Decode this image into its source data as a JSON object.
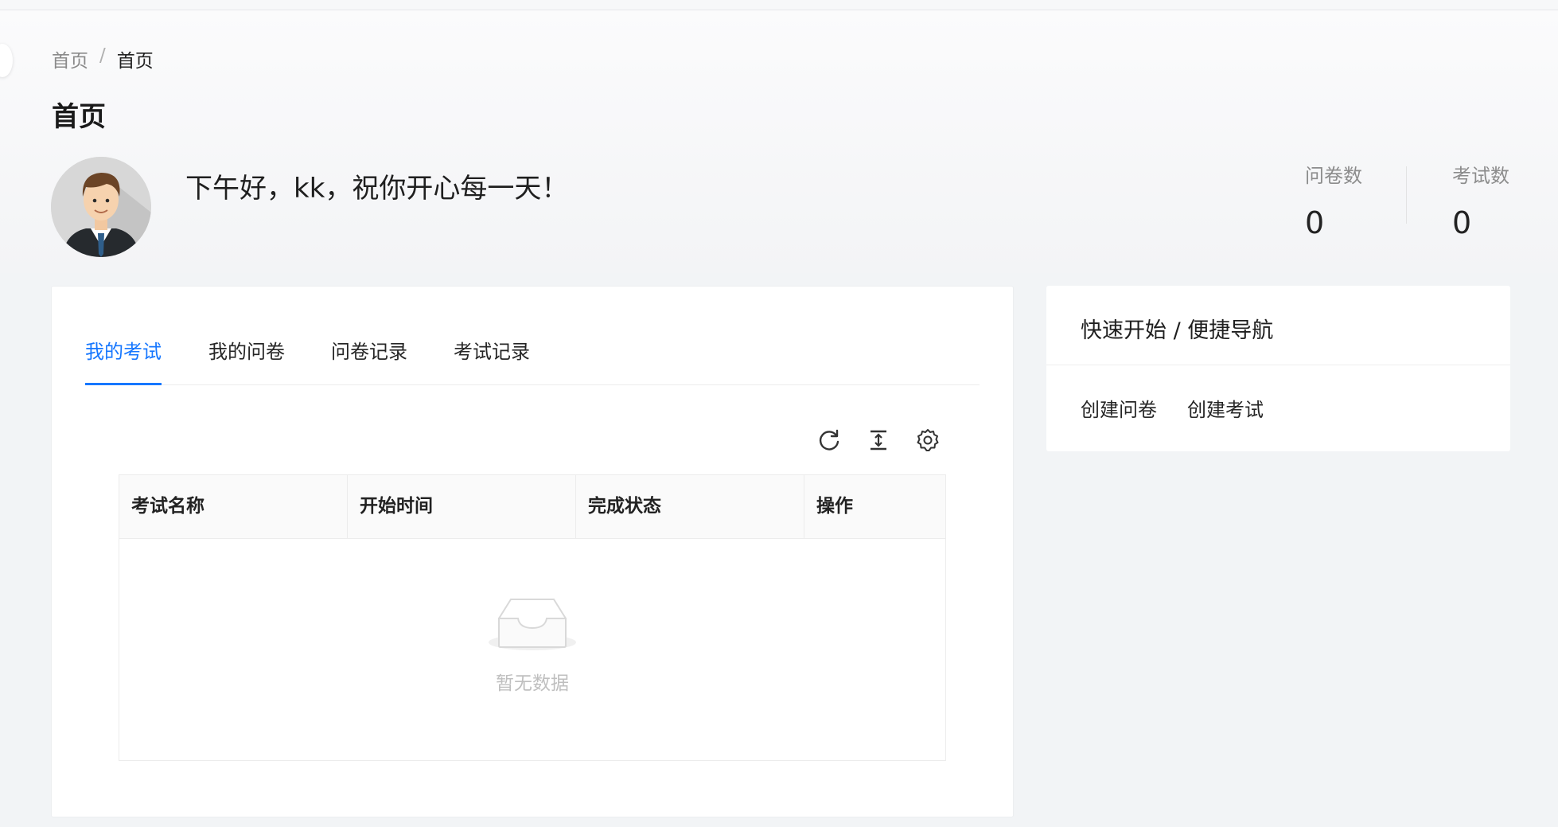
{
  "breadcrumb": {
    "root": "首页",
    "separator": "/",
    "current": "首页"
  },
  "page_title": "首页",
  "greeting": "下午好，kk，祝你开心每一天！",
  "stats": [
    {
      "label": "问卷数",
      "value": "0"
    },
    {
      "label": "考试数",
      "value": "0"
    }
  ],
  "tabs": [
    {
      "label": "我的考试",
      "active": true
    },
    {
      "label": "我的问卷",
      "active": false
    },
    {
      "label": "问卷记录",
      "active": false
    },
    {
      "label": "考试记录",
      "active": false
    }
  ],
  "toolbar": {
    "icons": [
      "reload-icon",
      "column-height-icon",
      "setting-icon"
    ]
  },
  "table": {
    "columns": [
      "考试名称",
      "开始时间",
      "完成状态",
      "操作"
    ],
    "rows": [],
    "empty_text": "暂无数据"
  },
  "quick_nav": {
    "title": "快速开始 / 便捷导航",
    "links": [
      "创建问卷",
      "创建考试"
    ]
  },
  "colors": {
    "accent": "#1677ff",
    "background": "#f2f4f6",
    "card": "#ffffff"
  }
}
